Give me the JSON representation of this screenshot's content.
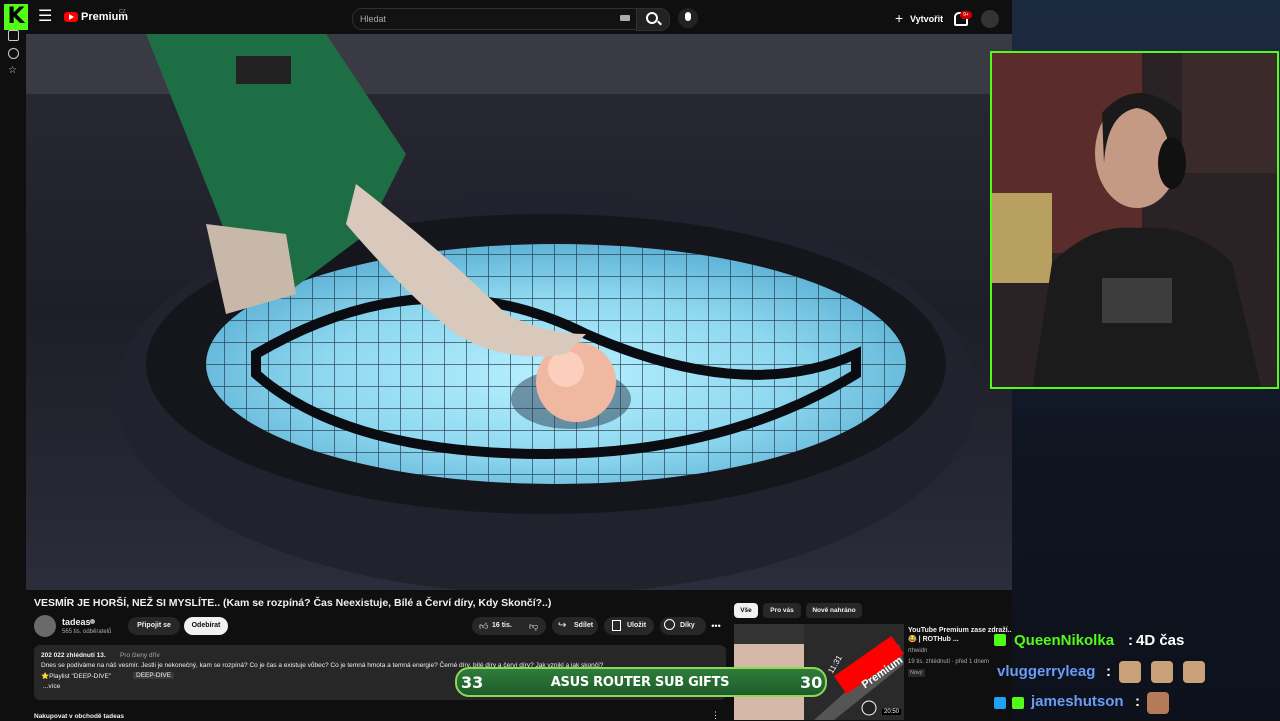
{
  "header": {
    "brand": "Premium",
    "country": "CZ",
    "search_placeholder": "Hledat",
    "create_label": "Vytvořit",
    "notifications": "9+"
  },
  "video": {
    "title": "VESMÍR JE HORŠÍ, NEŽ SI MYSLÍTE.. (Kam se rozpíná? Čas Neexistuje, Bílé a Červí díry, Kdy Skončí?..)"
  },
  "channel": {
    "name": "tadeas",
    "subscribers": "565 tis. odběratelů",
    "join_label": "Připojit se",
    "unsubscribe_label": "Odebírat"
  },
  "actions": {
    "likes": "16 tis.",
    "share_label": "Sdílet",
    "save_label": "Uložit",
    "thanks_label": "Díky"
  },
  "description": {
    "stats": "202 022 zhlédnutí  13.",
    "members": "Pro členy dřív",
    "text": "Dnes se podíváme na náš vesmír. Jestli je nekonečný, kam se rozpíná? Co je čas a existuje vůbec? Co je temná hmota a temná energie? Černé díry, bílé díry a červí díry? Jak vznikl a jak skončí?",
    "playlist": "⭐Playlist \"DEEP-DIVE\"",
    "playlist_tag": "DEEP-DIVE",
    "more": "...více"
  },
  "shop": {
    "label": "Nakupovat v obchodě tadeas"
  },
  "chips": [
    "Vše",
    "Pro vás",
    "Nově nahráno"
  ],
  "recommendation": {
    "title": "YouTube Premium zase zdraží.. 😂 | ROTHub ...",
    "channel": "rthwidn",
    "meta": "19 tis. zhlédnutí · před 1 dnem",
    "badge": "Nový",
    "duration": "20:50",
    "thumb_text": "Premium",
    "thumb_time": "11:31"
  },
  "gift_banner": {
    "left_count": "33",
    "text": "ASUS ROUTER SUB GIFTS",
    "right_count": "30"
  },
  "chat": [
    {
      "user": "QueenNikolka",
      "message": "4D čas"
    },
    {
      "user": "vluggerryleag",
      "message": ""
    },
    {
      "user": "jameshutson",
      "message": ""
    }
  ],
  "colors": {
    "kick_green": "#53fc18",
    "youtube_red": "#ff0000",
    "chip_active": "#f1f1f1",
    "background": "#0f0f0f"
  }
}
